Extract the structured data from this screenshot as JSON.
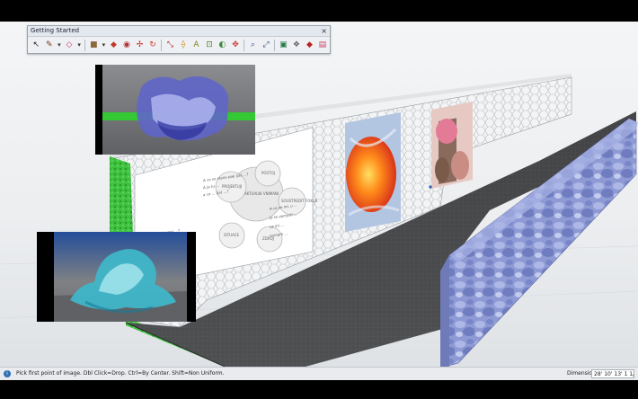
{
  "toolbar": {
    "title": "Getting Started",
    "close_icon": "×",
    "tools": [
      {
        "name": "select-tool-icon",
        "glyph": "↖",
        "color": "#222222"
      },
      {
        "name": "pencil-tool-icon",
        "glyph": "✎",
        "color": "#7a2f1a"
      },
      {
        "name": "line-tool-dropdown-icon",
        "glyph": "▾",
        "color": "#333333"
      },
      {
        "name": "eraser-tool-icon",
        "glyph": "◇",
        "color": "#cc3355"
      },
      {
        "name": "eraser-dropdown-icon",
        "glyph": "▾",
        "color": "#333333"
      },
      {
        "name": "shape-tool-icon",
        "glyph": "■",
        "color": "#8a6a3c"
      },
      {
        "name": "shape-dropdown-icon",
        "glyph": "▾",
        "color": "#333333"
      },
      {
        "name": "push-pull-tool-icon",
        "glyph": "◆",
        "color": "#c0392b"
      },
      {
        "name": "paint-bucket-tool-icon",
        "glyph": "◉",
        "color": "#b03030"
      },
      {
        "name": "move-tool-icon",
        "glyph": "✢",
        "color": "#cc2222"
      },
      {
        "name": "rotate-tool-icon",
        "glyph": "↻",
        "color": "#d03a2a"
      },
      {
        "name": "scale-tool-icon",
        "glyph": "⤡",
        "color": "#b02a2a"
      },
      {
        "name": "tape-measure-tool-icon",
        "glyph": "⟠",
        "color": "#c68a1a"
      },
      {
        "name": "text-tool-icon",
        "glyph": "A",
        "color": "#7a8a20"
      },
      {
        "name": "dimension-tool-icon",
        "glyph": "⊡",
        "color": "#4a7a2a"
      },
      {
        "name": "orbit-tool-icon",
        "glyph": "◐",
        "color": "#3a8a3a"
      },
      {
        "name": "pan-tool-icon",
        "glyph": "✥",
        "color": "#cc3333"
      },
      {
        "name": "zoom-tool-icon",
        "glyph": "⌕",
        "color": "#3a5a9a"
      },
      {
        "name": "zoom-extents-tool-icon",
        "glyph": "⤢",
        "color": "#2a4a8a"
      },
      {
        "name": "warehouse-icon",
        "glyph": "▣",
        "color": "#2a7a4a"
      },
      {
        "name": "components-icon",
        "glyph": "❖",
        "color": "#666666"
      },
      {
        "name": "extension-warehouse-icon",
        "glyph": "◆",
        "color": "#bb2222"
      },
      {
        "name": "layout-icon",
        "glyph": "▤",
        "color": "#cc4466"
      }
    ]
  },
  "status": {
    "text": "Pick first point of image. Dbl Click=Drop. Ctrl=By Center. Shift=Non Uniform.",
    "vcb_label": "Dimensions",
    "vcb_value": "28' 10' 13' 1 1/6\""
  },
  "scene": {
    "poster_text": {
      "left_lines": [
        "A co ... je to (mne) ...?",
        "A kolik stojim pr...",
        "A Mohu mi dohodnut ...?",
        "A co ... vyjadrit (ant.)...?",
        "A Jakj ... tuk co se zase ...?",
        "A si ( ma ) ..."
      ],
      "top_lines": [
        "A co se stane pak (ja) ...?",
        "A ja tu ...",
        "a co ... (ja) ...?"
      ],
      "right_lines": [
        "A co se mi, u ...",
        "ja se zamysli ...",
        "uz mi ...",
        "nemam ..."
      ],
      "bottom_left": "A u sebe, ... mozna ...",
      "circle_center": "AKTUALNI VNIMANI",
      "circle_1": "PROJEKTUJI",
      "circle_2": "POSTOJ",
      "circle_3": "SOUSTREDIT FOKUS",
      "circle_4": "SITUACE",
      "circle_5": "ZDROJ"
    }
  }
}
